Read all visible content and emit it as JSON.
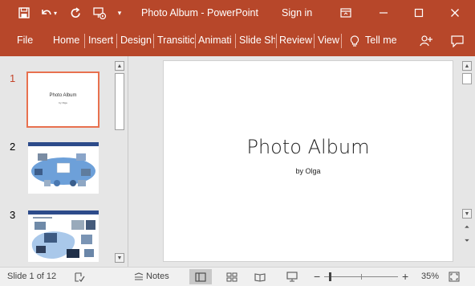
{
  "window": {
    "title": "Photo Album  -  PowerPoint",
    "sign_in": "Sign in"
  },
  "ribbon": {
    "tabs": [
      "File",
      "Home",
      "Insert",
      "Design",
      "Transitic",
      "Animati",
      "Slide Sh",
      "Review",
      "View"
    ],
    "tell_me": "Tell me"
  },
  "thumbnails": {
    "numbers": [
      "1",
      "2",
      "3"
    ],
    "slide1_title": "Photo Album",
    "slide1_sub": "by Olga"
  },
  "slide": {
    "title": "Photo Album",
    "subtitle": "by Olga"
  },
  "status": {
    "slide_info": "Slide 1 of 12",
    "notes": "Notes",
    "zoom": "35%"
  },
  "colors": {
    "accent": "#b7472a",
    "selected_border": "#e8714f"
  }
}
